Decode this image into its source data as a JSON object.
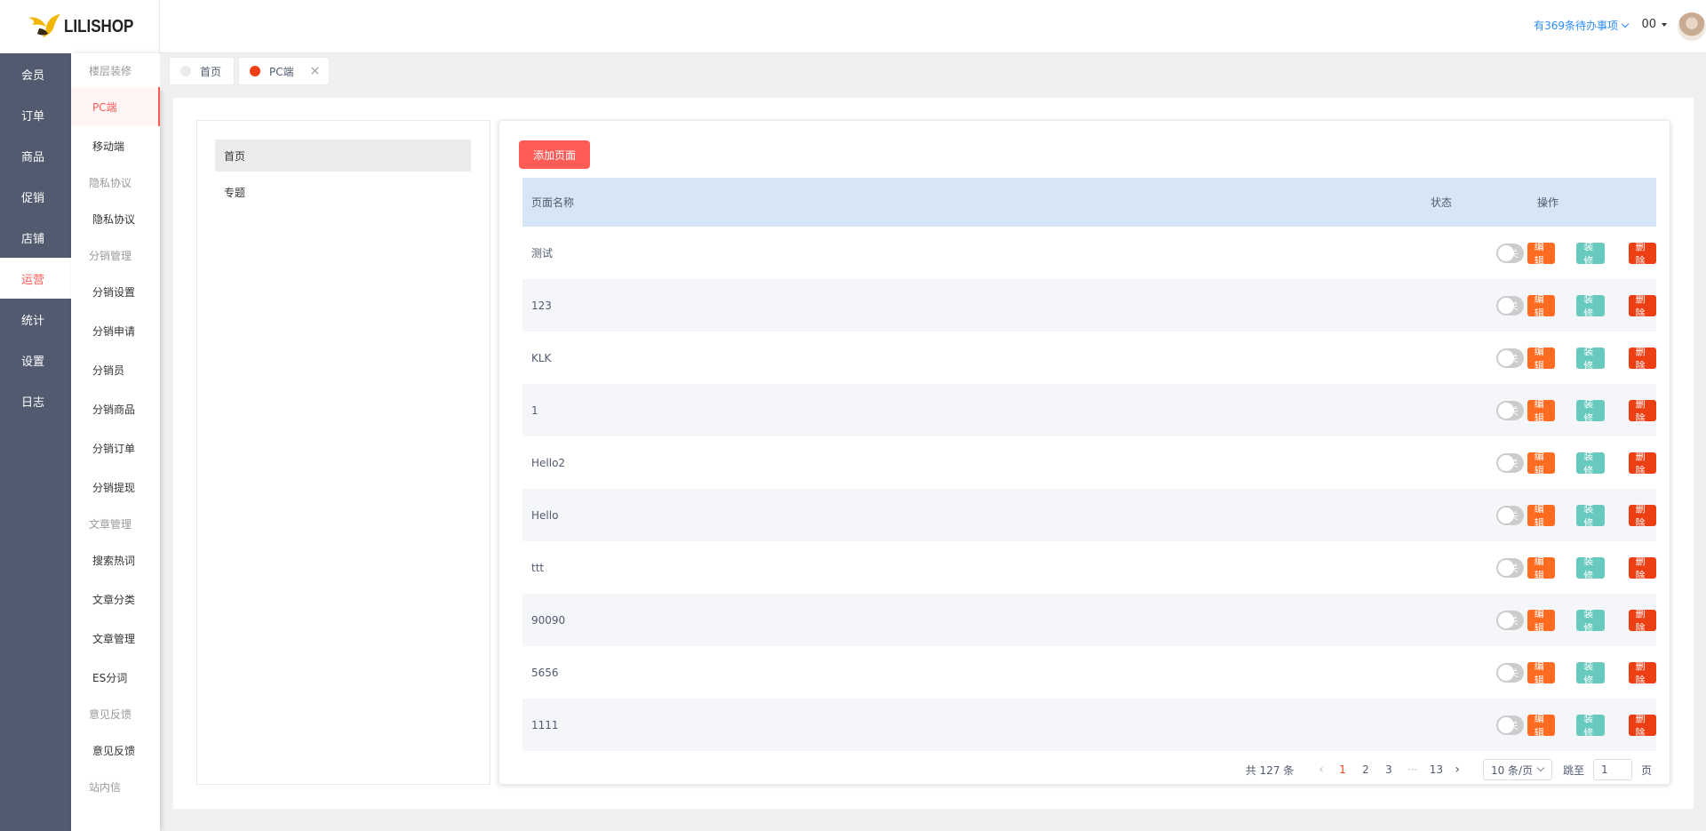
{
  "brand": {
    "name": "LILISHOP"
  },
  "header": {
    "todo_label": "有369条待办事项",
    "user_name": "00"
  },
  "nav_primary": [
    {
      "label": "会员"
    },
    {
      "label": "订单"
    },
    {
      "label": "商品"
    },
    {
      "label": "促销"
    },
    {
      "label": "店铺"
    },
    {
      "label": "运营",
      "active": true
    },
    {
      "label": "统计"
    },
    {
      "label": "设置"
    },
    {
      "label": "日志"
    }
  ],
  "nav_secondary": {
    "g1": "楼层装修",
    "g1_items": [
      "PC端",
      "移动端"
    ],
    "g2": "隐私协议",
    "g2_items": [
      "隐私协议"
    ],
    "g3": "分销管理",
    "g3_items": [
      "分销设置",
      "分销申请",
      "分销员",
      "分销商品",
      "分销订单",
      "分销提现"
    ],
    "g4": "文章管理",
    "g4_items": [
      "搜索热词",
      "文章分类",
      "文章管理",
      "ES分词"
    ],
    "g5": "意见反馈",
    "g5_items": [
      "意见反馈"
    ],
    "g6": "站内信"
  },
  "tabs": [
    {
      "label": "首页"
    },
    {
      "label": "PC端",
      "closable": true
    }
  ],
  "categories": [
    "首页",
    "专题"
  ],
  "main": {
    "add_button": "添加页面",
    "columns": {
      "name": "页面名称",
      "status": "状态",
      "ops": "操作"
    },
    "switch_off_label": "关",
    "op_labels": {
      "edit": "编辑",
      "decorate": "装修",
      "delete": "删除"
    },
    "rows": [
      {
        "name": "测试",
        "status": "关"
      },
      {
        "name": "123",
        "status": "关"
      },
      {
        "name": "KLK",
        "status": "关"
      },
      {
        "name": "1",
        "status": "关"
      },
      {
        "name": "Hello2",
        "status": "关"
      },
      {
        "name": "Hello",
        "status": "关"
      },
      {
        "name": "ttt",
        "status": "关"
      },
      {
        "name": "90090",
        "status": "关"
      },
      {
        "name": "5656",
        "status": "关"
      },
      {
        "name": "1111",
        "status": "关"
      }
    ]
  },
  "pagination": {
    "total_label": "共 127 条",
    "pages": [
      "1",
      "2",
      "3",
      "13"
    ],
    "ellipsis": "···",
    "current": "1",
    "page_size_label": "10 条/页",
    "jump_label": "跳至",
    "jump_value": "1",
    "page_unit": "页"
  },
  "colors": {
    "accent": "#ff5c58",
    "sidebar": "#515a6e",
    "edit": "#ff6b21",
    "decorate": "#68cabe",
    "delete": "#ed3f14"
  }
}
